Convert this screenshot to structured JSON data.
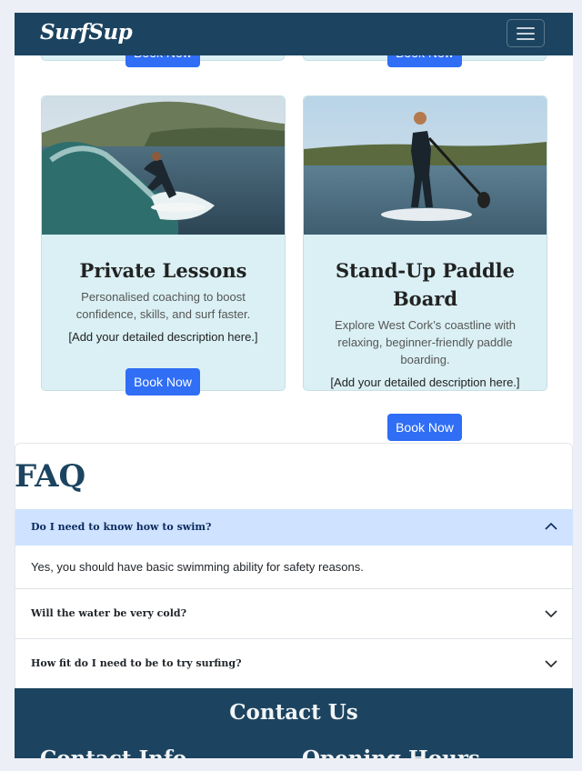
{
  "navbar": {
    "brand": "SurfSup",
    "toggler_icon": "hamburger-icon"
  },
  "previous_cards": {
    "button_label": "Book Now"
  },
  "services": [
    {
      "title": "Private Lessons",
      "text": "Personalised coaching to boost confidence, skills, and surf faster.",
      "description": "[Add your detailed description here.]",
      "button_label": "Book Now",
      "image": "surfer riding a wave"
    },
    {
      "title": "Stand-Up Paddle Board",
      "text": "Explore West Cork’s coastline with relaxing, beginner-friendly paddle boarding.",
      "description": "[Add your detailed description here.]",
      "button_label": "Book Now",
      "image": "paddle boarder on calm water"
    }
  ],
  "faq": {
    "title": "FAQ",
    "items": [
      {
        "question": "Do I need to know how to swim?",
        "answer": "Yes, you should have basic swimming ability for safety reasons.",
        "expanded": true,
        "icon": "chevron-up-icon"
      },
      {
        "question": "Will the water be very cold?",
        "expanded": false,
        "icon": "chevron-down-icon"
      },
      {
        "question": "How fit do I need to be to try surfing?",
        "expanded": false,
        "icon": "chevron-down-icon"
      }
    ]
  },
  "contact": {
    "title": "Contact Us",
    "info_heading": "Contact Info",
    "hours_heading": "Opening Hours"
  },
  "colors": {
    "navy": "#1c4460",
    "card_bg": "#daf0f4",
    "button": "#2f6ef5",
    "accordion_active": "#cfe2ff"
  }
}
